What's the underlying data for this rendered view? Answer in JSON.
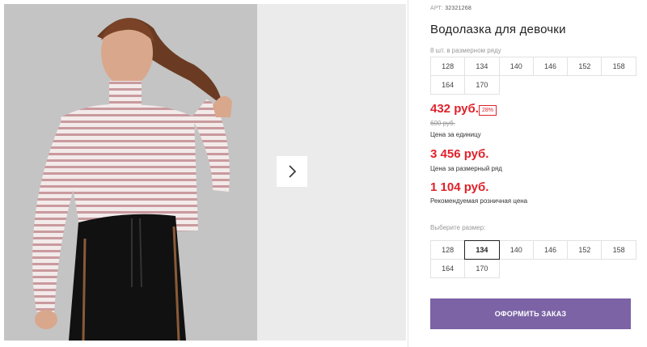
{
  "product": {
    "article_label": "АРТ:",
    "article_number": "32321268",
    "title": "Водолазка для девочки",
    "pack_label": "8 шт. в размерном ряду",
    "pack_sizes": [
      "128",
      "134",
      "140",
      "146",
      "152",
      "158",
      "164",
      "170"
    ],
    "price": "432 руб.",
    "discount": "28%",
    "old_price": "600 руб.",
    "unit_price_caption": "Цена за единицу",
    "pack_price": "3 456 руб.",
    "pack_price_caption": "Цена за размерный ряд",
    "retail_price": "1 104 руб.",
    "retail_price_caption": "Рекомендуемая розничная цена",
    "choose_size_label": "Выберите размер:",
    "sizes": [
      "128",
      "134",
      "140",
      "146",
      "152",
      "158",
      "164",
      "170"
    ],
    "selected_size": "134",
    "order_button": "ОФОРМИТЬ ЗАКАЗ"
  },
  "gallery": {
    "next_icon": "chevron-right-icon"
  },
  "colors": {
    "accent": "#7b63a5",
    "price": "#e0212a"
  }
}
